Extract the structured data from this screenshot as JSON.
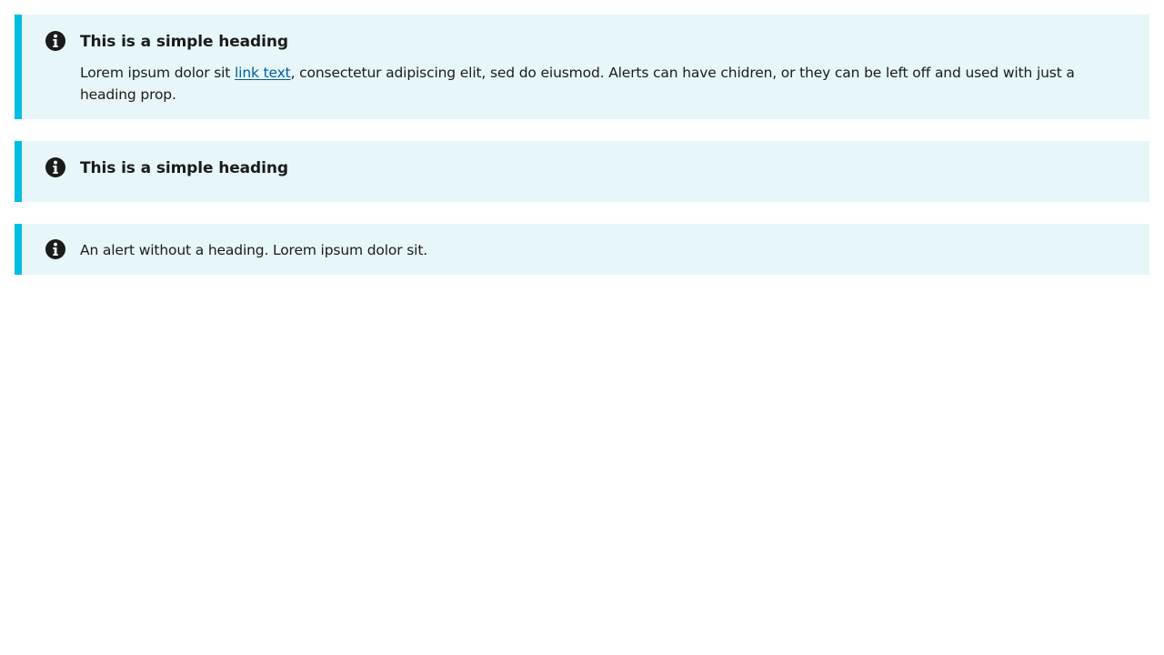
{
  "colors": {
    "alert_background": "#e7f6f8",
    "alert_accent": "#00bde3",
    "text": "#1b1b1b",
    "link": "#005ea2",
    "page_background": "#ffffff"
  },
  "alerts": [
    {
      "type": "info",
      "icon": "info-icon",
      "heading": "This is a simple heading",
      "text_before_link": "Lorem ipsum dolor sit ",
      "link_text": "link text",
      "text_after_link": ", consectetur adipiscing elit, sed do eiusmod. Alerts can have chidren, or they can be left off and used with just a heading prop."
    },
    {
      "type": "info",
      "icon": "info-icon",
      "heading": "This is a simple heading"
    },
    {
      "type": "info",
      "icon": "info-icon",
      "text": "An alert without a heading. Lorem ipsum dolor sit."
    }
  ]
}
